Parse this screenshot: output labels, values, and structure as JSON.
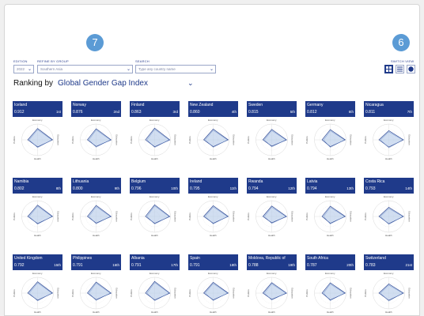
{
  "badges": {
    "left": "7",
    "right": "6"
  },
  "controls": {
    "edition_label": "EDITION",
    "edition_value": "2022",
    "group_label": "REFINE BY GROUP",
    "group_value": "Southern Asia",
    "search_label": "SEARCH",
    "search_placeholder": "Type any country name",
    "switch_label": "SWITCH VIEW"
  },
  "ranking": {
    "prefix": "Ranking by",
    "index": "Global Gender Gap Index"
  },
  "axis_labels": {
    "top": "Economy",
    "left": "Politics",
    "right": "Education",
    "bottom": "Health"
  },
  "countries": [
    {
      "name": "Iceland",
      "score": "0.912",
      "rank": "1st"
    },
    {
      "name": "Norway",
      "score": "0.876",
      "rank": "2nd"
    },
    {
      "name": "Finland",
      "score": "0.863",
      "rank": "3rd"
    },
    {
      "name": "New Zealand",
      "score": "0.860",
      "rank": "4th"
    },
    {
      "name": "Sweden",
      "score": "0.815",
      "rank": "5th"
    },
    {
      "name": "Germany",
      "score": "0.812",
      "rank": "6th"
    },
    {
      "name": "Nicaragua",
      "score": "0.811",
      "rank": "7th"
    },
    {
      "name": "Namibia",
      "score": "0.802",
      "rank": "8th"
    },
    {
      "name": "Lithuania",
      "score": "0.800",
      "rank": "9th"
    },
    {
      "name": "Belgium",
      "score": "0.796",
      "rank": "10th"
    },
    {
      "name": "Ireland",
      "score": "0.795",
      "rank": "11th"
    },
    {
      "name": "Rwanda",
      "score": "0.794",
      "rank": "12th"
    },
    {
      "name": "Latvia",
      "score": "0.794",
      "rank": "13th"
    },
    {
      "name": "Costa Rica",
      "score": "0.793",
      "rank": "14th"
    },
    {
      "name": "United Kingdom",
      "score": "0.792",
      "rank": "15th"
    },
    {
      "name": "Philippines",
      "score": "0.791",
      "rank": "16th"
    },
    {
      "name": "Albania",
      "score": "0.791",
      "rank": "17th"
    },
    {
      "name": "Spain",
      "score": "0.791",
      "rank": "18th"
    },
    {
      "name": "Moldova, Republic of",
      "score": "0.788",
      "rank": "19th"
    },
    {
      "name": "South Africa",
      "score": "0.787",
      "rank": "20th"
    },
    {
      "name": "Switzerland",
      "score": "0.783",
      "rank": "21st"
    }
  ]
}
